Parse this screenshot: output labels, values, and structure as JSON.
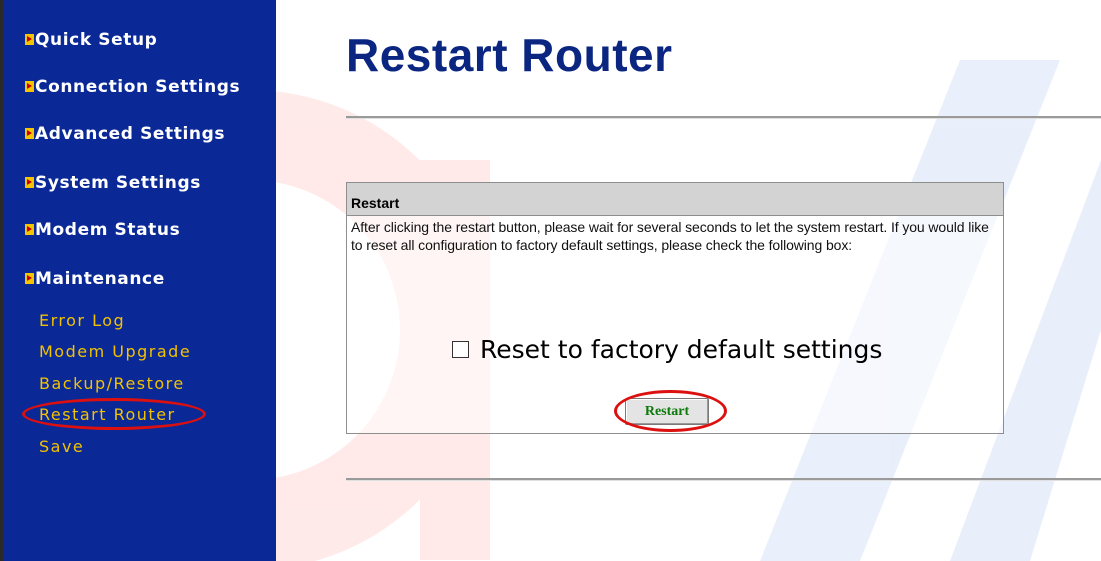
{
  "sidebar": {
    "menu": [
      {
        "label": "Quick Setup"
      },
      {
        "label": "Connection Settings"
      },
      {
        "label": "Advanced Settings"
      },
      {
        "label": "System Settings"
      },
      {
        "label": "Modem Status"
      },
      {
        "label": "Maintenance"
      }
    ],
    "submenu": [
      {
        "label": "Error Log"
      },
      {
        "label": "Modem Upgrade"
      },
      {
        "label": "Backup/Restore"
      },
      {
        "label": "Restart Router"
      },
      {
        "label": "Save"
      }
    ]
  },
  "main": {
    "title": "Restart Router",
    "panel": {
      "header": "Restart",
      "text": "After clicking the restart button, please wait for several seconds to let the system restart. If you would like to reset all configuration to factory default settings, please check the following box:",
      "checkbox_label": "Reset to factory default settings",
      "checkbox_checked": false,
      "button_label": "Restart"
    }
  },
  "colors": {
    "sidebar_bg": "#0a2896",
    "menu_text": "#ffffff",
    "submenu_text": "#f2c200",
    "title": "#0a2680",
    "button_text": "#0b7a0b",
    "highlight": "#dd1010"
  }
}
